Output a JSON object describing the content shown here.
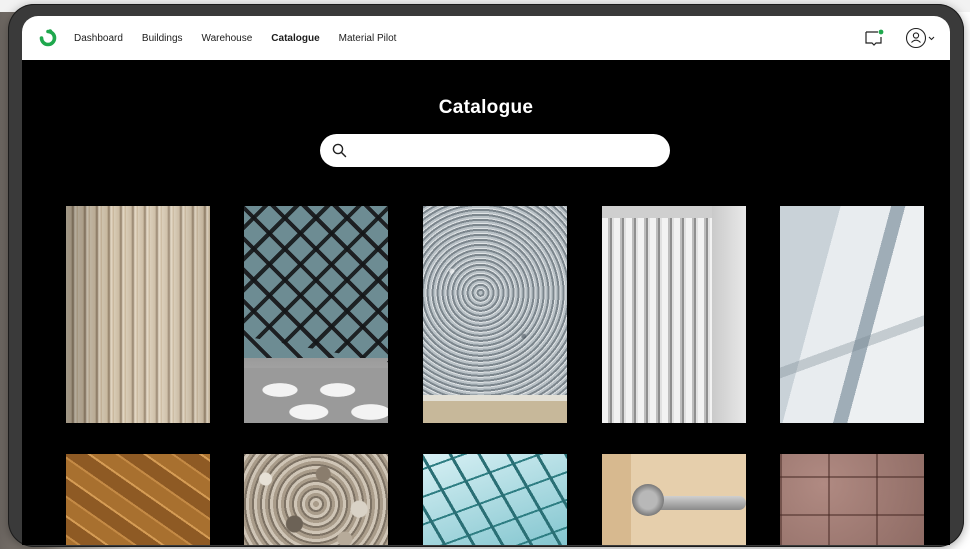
{
  "nav": {
    "links": [
      "Dashboard",
      "Buildings",
      "Warehouse",
      "Catalogue",
      "Material Pilot"
    ],
    "active": "Catalogue"
  },
  "page": {
    "title": "Catalogue"
  },
  "search": {
    "placeholder": "",
    "value": ""
  },
  "icons": {
    "logo": "refresh-logo-icon",
    "messages": "message-icon",
    "user": "user-circle-icon",
    "dropdown": "chevron-down-icon",
    "search": "search-icon"
  },
  "colors": {
    "brand": "#1fa84d",
    "background": "#000000",
    "nav_background": "#ffffff"
  }
}
